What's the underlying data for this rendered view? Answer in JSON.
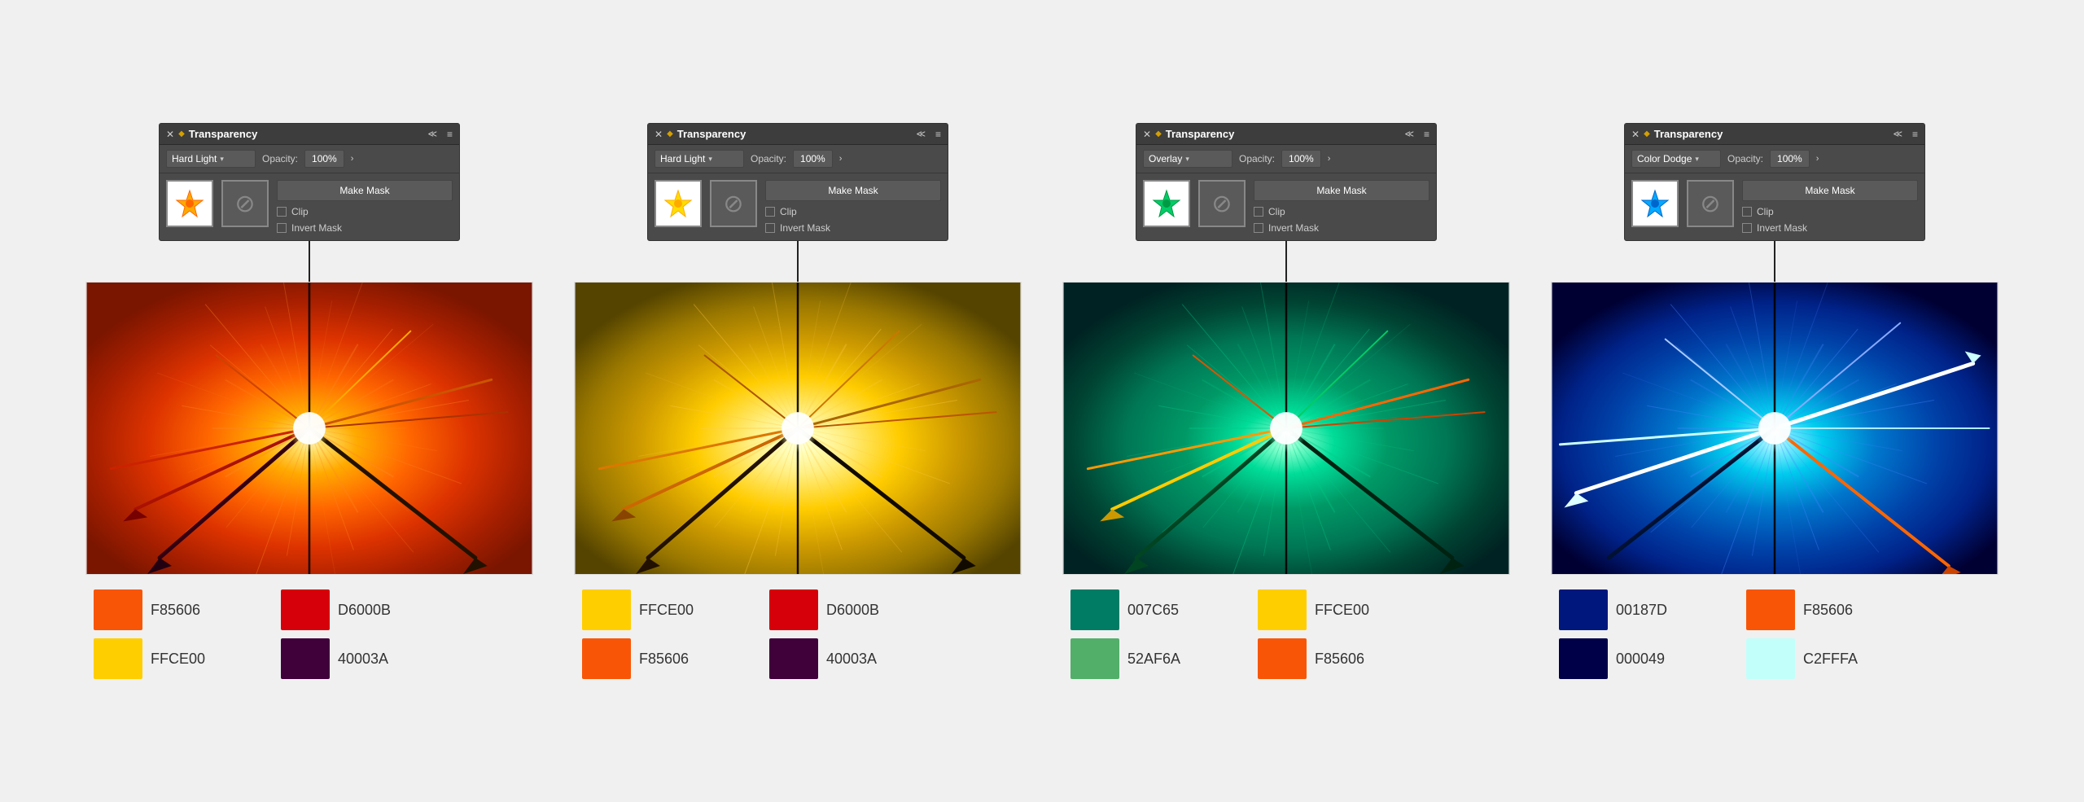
{
  "panels": [
    {
      "id": "panel1",
      "title": "Transparency",
      "blendMode": "Hard Light",
      "opacity": "100%",
      "makeMaskLabel": "Make Mask",
      "clipLabel": "Clip",
      "invertMaskLabel": "Invert Mask",
      "canvasType": "orange",
      "swatches": [
        {
          "color": "#F85606",
          "code": "F85606"
        },
        {
          "color": "#D6000B",
          "code": "D6000B"
        },
        {
          "color": "#FFCE00",
          "code": "FFCE00"
        },
        {
          "color": "#40003A",
          "code": "40003A"
        }
      ]
    },
    {
      "id": "panel2",
      "title": "Transparency",
      "blendMode": "Hard Light",
      "opacity": "100%",
      "makeMaskLabel": "Make Mask",
      "clipLabel": "Clip",
      "invertMaskLabel": "Invert Mask",
      "canvasType": "yellow",
      "swatches": [
        {
          "color": "#FFCE00",
          "code": "FFCE00"
        },
        {
          "color": "#D6000B",
          "code": "D6000B"
        },
        {
          "color": "#F85606",
          "code": "F85606"
        },
        {
          "color": "#40003A",
          "code": "40003A"
        }
      ]
    },
    {
      "id": "panel3",
      "title": "Transparency",
      "blendMode": "Overlay",
      "opacity": "100%",
      "makeMaskLabel": "Make Mask",
      "clipLabel": "Clip",
      "invertMaskLabel": "Invert Mask",
      "canvasType": "green",
      "swatches": [
        {
          "color": "#007C65",
          "code": "007C65"
        },
        {
          "color": "#FFCE00",
          "code": "FFCE00"
        },
        {
          "color": "#52AF6A",
          "code": "52AF6A"
        },
        {
          "color": "#F85606",
          "code": "F85606"
        }
      ]
    },
    {
      "id": "panel4",
      "title": "Transparency",
      "blendMode": "Color Dodge",
      "opacity": "100%",
      "makeMaskLabel": "Make Mask",
      "clipLabel": "Clip",
      "invertMaskLabel": "Invert Mask",
      "canvasType": "blue",
      "swatches": [
        {
          "color": "#00187D",
          "code": "00187D"
        },
        {
          "color": "#F85606",
          "code": "F85606"
        },
        {
          "color": "#000049",
          "code": "000049"
        },
        {
          "color": "#C2FFFA",
          "code": "C2FFFA"
        }
      ]
    }
  ]
}
